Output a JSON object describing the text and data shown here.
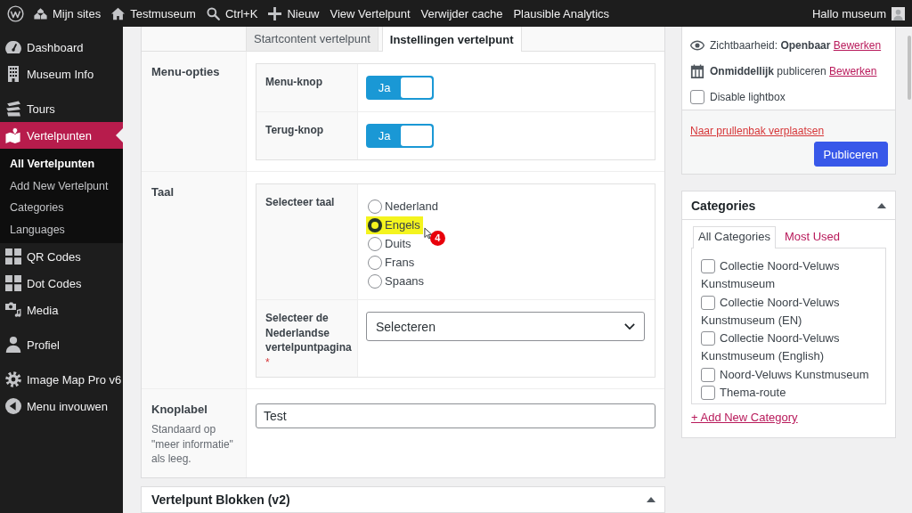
{
  "admin_bar": {
    "items": [
      {
        "kind": "sites",
        "label": "Mijn sites"
      },
      {
        "kind": "site",
        "label": "Testmuseum"
      },
      {
        "kind": "search",
        "label": "Ctrl+K"
      },
      {
        "kind": "new",
        "label": "Nieuw"
      },
      {
        "kind": "link",
        "label": "View Vertelpunt"
      },
      {
        "kind": "link",
        "label": "Verwijder cache"
      },
      {
        "kind": "link",
        "label": "Plausible Analytics"
      }
    ],
    "account": "Hallo museum"
  },
  "sidebar": {
    "groups": [
      {
        "items": [
          {
            "label": "Dashboard",
            "selected": false
          },
          {
            "label": "Museum Info",
            "selected": false
          }
        ]
      },
      {
        "items": [
          {
            "label": "Tours",
            "selected": false
          },
          {
            "label": "Vertelpunten",
            "selected": true,
            "children": [
              {
                "label": "All Vertelpunten",
                "selected": true
              },
              {
                "label": "Add New Vertelpunt",
                "selected": false
              },
              {
                "label": "Categories",
                "selected": false
              },
              {
                "label": "Languages",
                "selected": false
              }
            ]
          },
          {
            "label": "QR Codes",
            "selected": false
          },
          {
            "label": "Dot Codes",
            "selected": false
          },
          {
            "label": "Media",
            "selected": false
          }
        ]
      },
      {
        "items": [
          {
            "label": "Profiel",
            "selected": false
          }
        ]
      },
      {
        "items": [
          {
            "label": "Image Map Pro v6",
            "selected": false
          },
          {
            "label": "Menu invouwen",
            "selected": false
          }
        ]
      }
    ]
  },
  "editor": {
    "tabs": [
      {
        "label": "Startcontent vertelpunt",
        "selected": false
      },
      {
        "label": "Instellingen vertelpunt",
        "selected": true
      }
    ],
    "fields": [
      {
        "kind": "group",
        "label": "Menu-opties",
        "subfields": [
          {
            "kind": "toggle",
            "label": "Menu-knop",
            "on": true,
            "text": "Ja"
          },
          {
            "kind": "toggle",
            "label": "Terug-knop",
            "on": true,
            "text": "Ja"
          }
        ]
      },
      {
        "kind": "group",
        "label": "Taal",
        "subfields": [
          {
            "kind": "radio",
            "label": "Selecteer taal",
            "options": [
              {
                "label": "Nederland",
                "selected": false,
                "highlighted": false
              },
              {
                "label": "Engels",
                "selected": true,
                "highlighted": true,
                "callout": "4"
              },
              {
                "label": "Duits",
                "selected": false,
                "highlighted": false
              },
              {
                "label": "Frans",
                "selected": false,
                "highlighted": false
              },
              {
                "label": "Spaans",
                "selected": false,
                "highlighted": false
              }
            ]
          },
          {
            "kind": "select",
            "label": "Selecteer de Nederlandse vertelpuntpagina",
            "required_mark": "*",
            "value": "Selecteren"
          }
        ]
      },
      {
        "kind": "text",
        "label": "Knoplabel",
        "description": "Standaard op \"meer informatie\" als leeg.",
        "value": "Test"
      }
    ]
  },
  "blocks_box": {
    "title": "Vertelpunt Blokken (v2)"
  },
  "publish": {
    "visibility": "Zichtbaarheid: **Openbaar**",
    "visibility_link": "Bewerken",
    "schedule": "**Onmiddellijk** publiceren",
    "schedule_link": "Bewerken",
    "lightbox": {
      "label": "Disable lightbox",
      "checked": false
    },
    "trash_link": "Naar prullenbak verplaatsen",
    "button": "Publiceren"
  },
  "categories": {
    "title": "Categories",
    "tabs": [
      {
        "label": "All Categories",
        "selected": true
      },
      {
        "label": "Most Used",
        "selected": false
      }
    ],
    "items": [
      {
        "label": "Collectie Noord-Veluws Kunstmuseum",
        "checked": false
      },
      {
        "label": "Collectie Noord-Veluws Kunstmuseum (EN)",
        "checked": false
      },
      {
        "label": "Collectie Noord-Veluws Kunstmuseum (English)",
        "checked": false
      },
      {
        "label": "Noord-Veluws Kunstmuseum",
        "checked": false
      },
      {
        "label": "Thema-route",
        "checked": false
      }
    ],
    "add_link": "+ Add New Category"
  }
}
